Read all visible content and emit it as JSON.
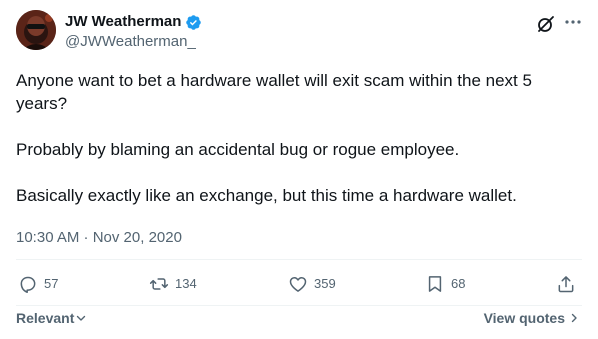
{
  "author": {
    "name": "JW Weatherman",
    "handle": "@JWWeatherman_",
    "verified": true,
    "verified_color": "#1d9bf0"
  },
  "header_icons": {
    "grok": "grok-icon",
    "more": "more-icon"
  },
  "tweet": {
    "paragraphs": [
      "Anyone want to bet a hardware wallet will exit scam within the next 5 years?",
      "Probably by blaming an accidental bug or rogue employee.",
      "Basically exactly like an exchange, but this time a hardware wallet."
    ],
    "timestamp": "10:30 AM · Nov 20, 2020"
  },
  "actions": {
    "reply_count": "57",
    "retweet_count": "134",
    "like_count": "359",
    "bookmark_count": "68",
    "icons": [
      "reply-icon",
      "retweet-icon",
      "like-icon",
      "bookmark-icon",
      "share-icon"
    ]
  },
  "footer": {
    "sort_label": "Relevant",
    "view_quotes_label": "View quotes"
  },
  "colors": {
    "text": "#0f1419",
    "secondary": "#536471",
    "divider": "#eff3f4"
  }
}
